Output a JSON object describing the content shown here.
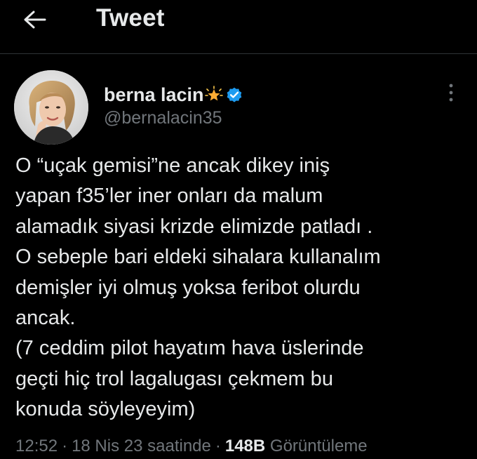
{
  "header": {
    "title": "Tweet",
    "back_icon": "arrow-left-icon"
  },
  "author": {
    "display_name": "berna lacin",
    "name_emoji_icon": "glowing-star-icon",
    "verified_icon": "verified-badge-icon",
    "handle": "@bernalacin35",
    "more_icon": "more-vertical-icon"
  },
  "tweet": {
    "lines": [
      "O “uçak gemisi”ne ancak dikey iniş",
      "yapan f35’ler iner onları da malum",
      "alamadık siyasi krizde elimizde patladı .",
      "O sebeple bari eldeki sihalara kullanalım",
      "demişler iyi olmuş yoksa feribot olurdu",
      "ancak.",
      "(7 ceddim pilot hayatım hava üslerinde",
      "geçti hiç trol lagalugası çekmem bu",
      "konuda söyleyeyim)"
    ]
  },
  "meta": {
    "time": "12:52",
    "separator": "·",
    "date": "18 Nis 23 saatinde",
    "views_count": "148B",
    "views_label": "Görüntüleme"
  },
  "colors": {
    "background": "#000000",
    "text_primary": "#e7e9ea",
    "text_secondary": "#71767b",
    "verified": "#1d9bf0",
    "divider": "#2f3336"
  }
}
